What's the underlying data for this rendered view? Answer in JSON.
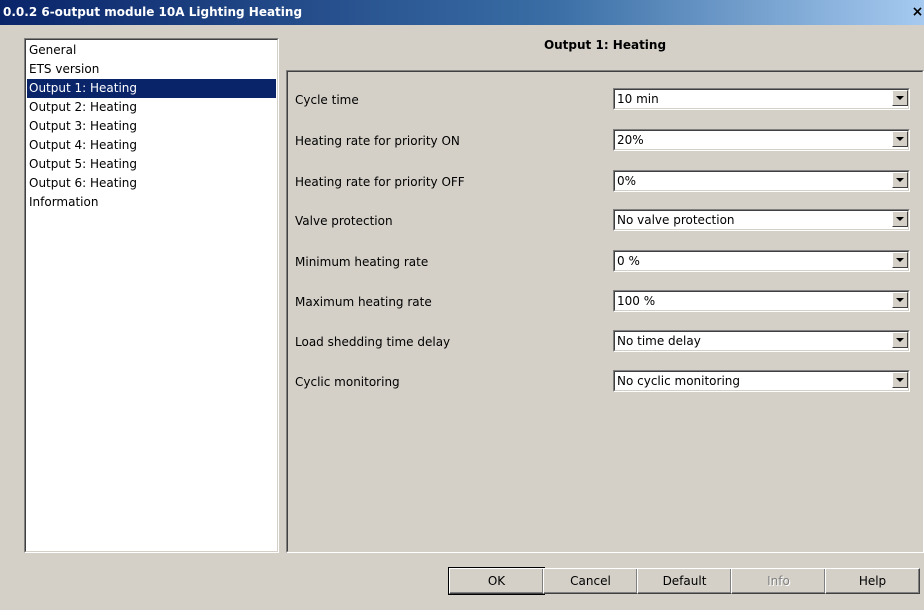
{
  "window": {
    "title": "0.0.2 6-output module 10A Lighting Heating",
    "close_glyph": "×"
  },
  "sidebar": {
    "items": [
      {
        "label": "General"
      },
      {
        "label": "ETS version"
      },
      {
        "label": "Output 1: Heating",
        "selected": true
      },
      {
        "label": "Output 2: Heating"
      },
      {
        "label": "Output 3: Heating"
      },
      {
        "label": "Output 4: Heating"
      },
      {
        "label": "Output 5: Heating"
      },
      {
        "label": "Output 6: Heating"
      },
      {
        "label": "Information"
      }
    ]
  },
  "panel": {
    "heading": "Output 1: Heating",
    "params": [
      {
        "label": "Cycle time",
        "value": "10 min"
      },
      {
        "label": "Heating rate for priority ON",
        "value": "20%"
      },
      {
        "label": "Heating rate for priority OFF",
        "value": "0%"
      },
      {
        "label": "Valve protection",
        "value": "No valve protection"
      },
      {
        "label": "Minimum heating rate",
        "value": "0 %"
      },
      {
        "label": "Maximum heating rate",
        "value": "100 %"
      },
      {
        "label": "Load shedding time delay",
        "value": "No time delay"
      },
      {
        "label": "Cyclic monitoring",
        "value": "No cyclic monitoring"
      }
    ]
  },
  "buttons": {
    "ok": "OK",
    "cancel": "Cancel",
    "default": "Default",
    "info": "Info",
    "help": "Help"
  },
  "colors": {
    "selection": "#0a246a",
    "face": "#d4d0c8"
  }
}
